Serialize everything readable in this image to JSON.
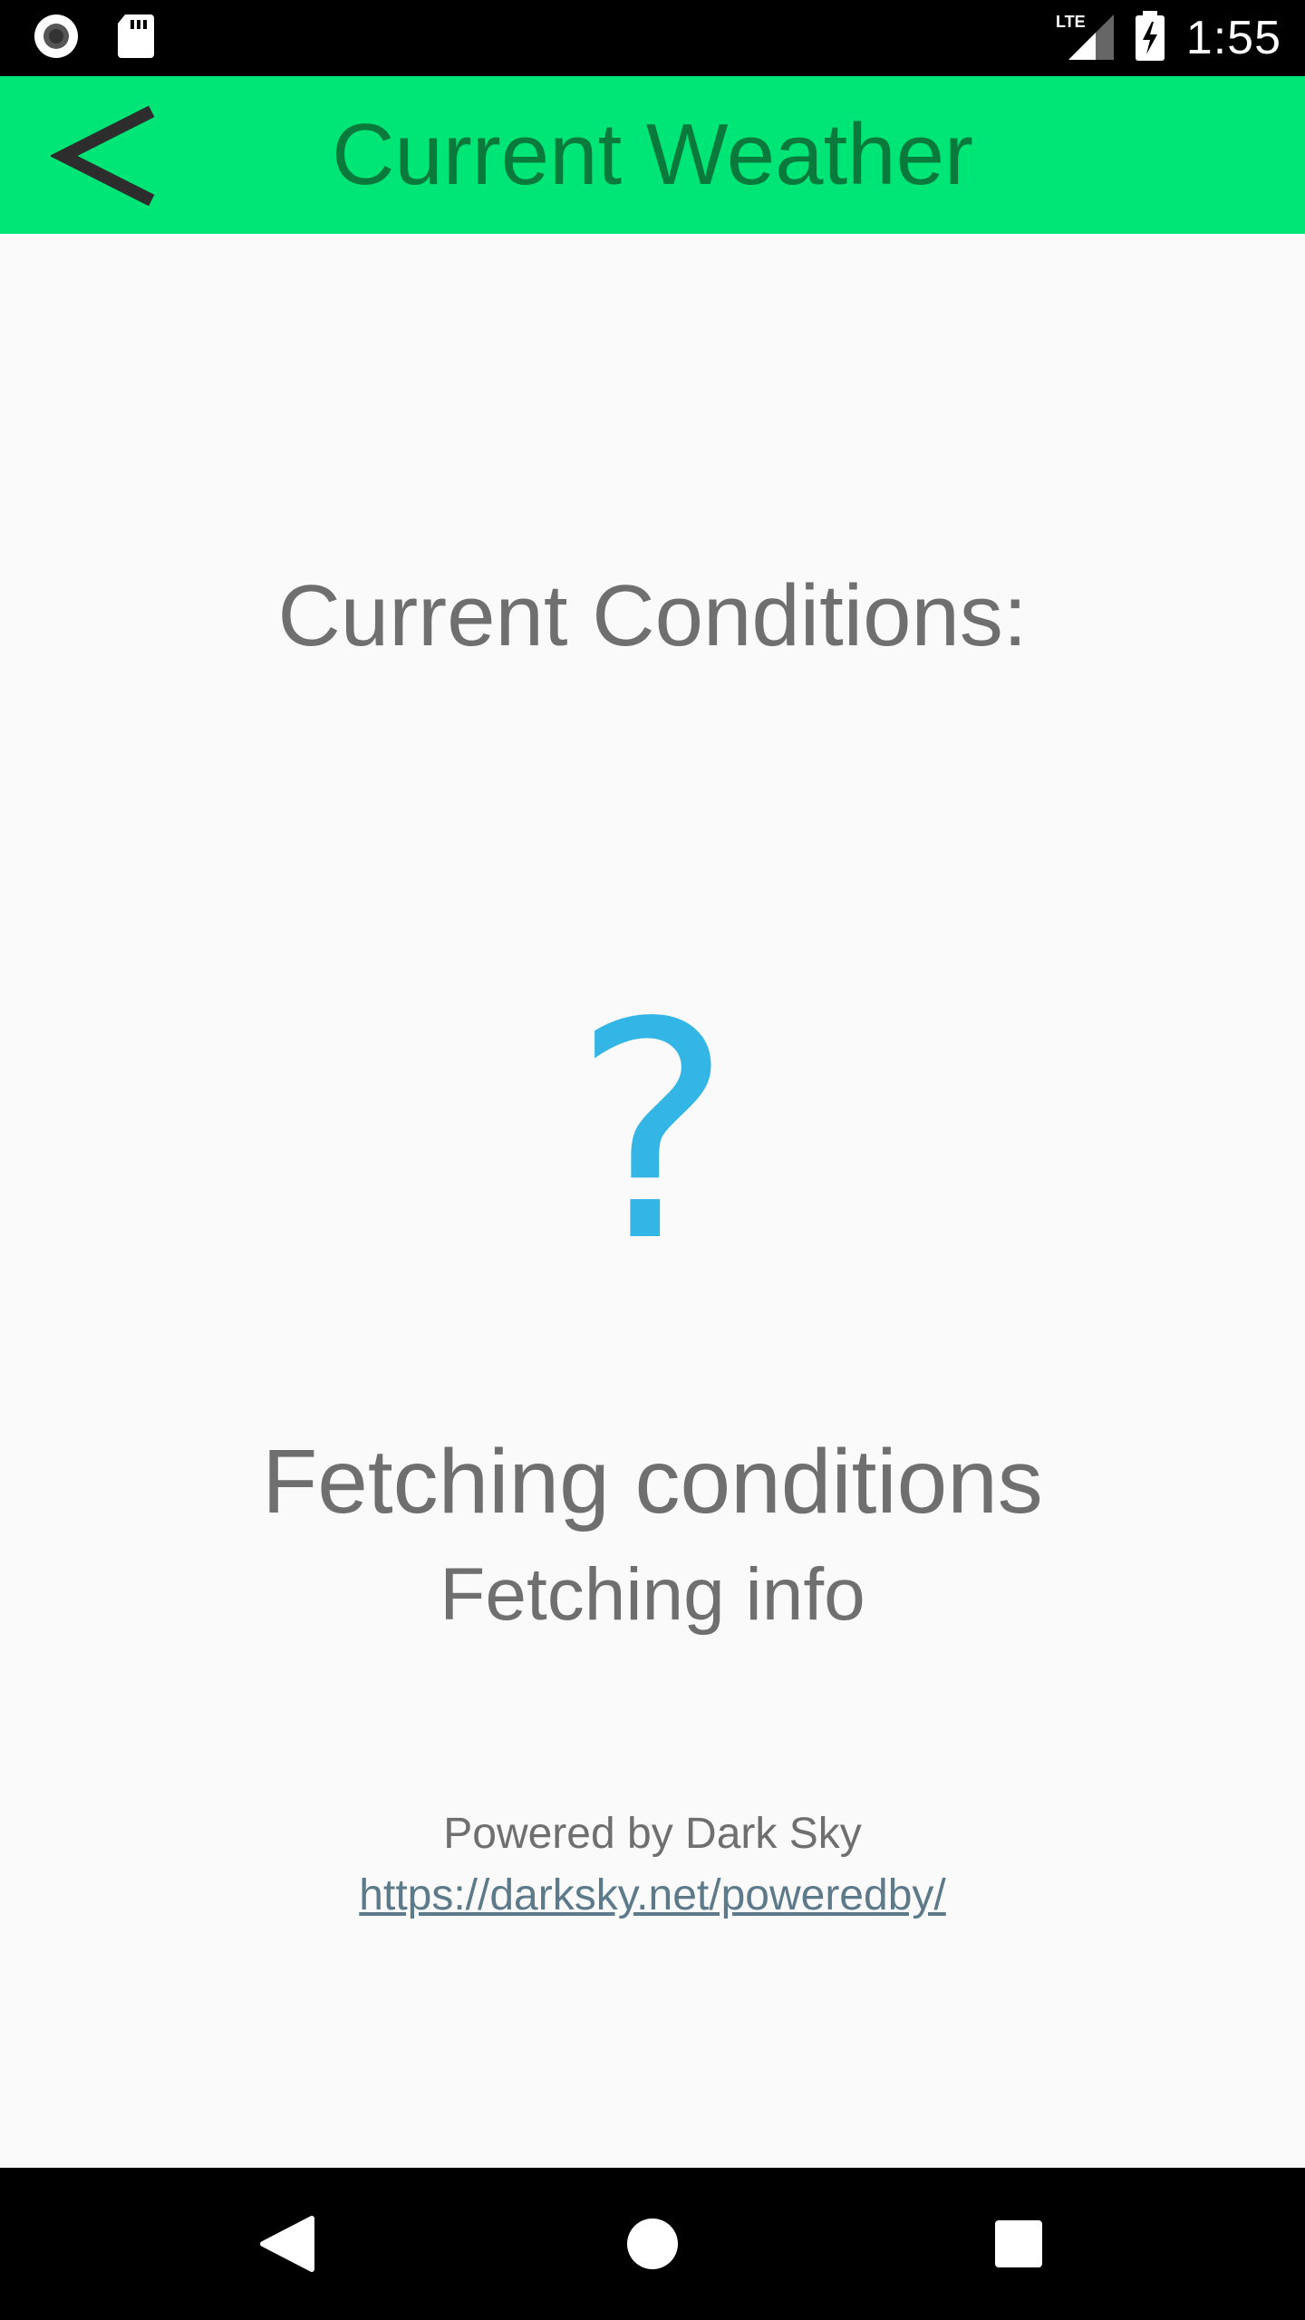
{
  "status_bar": {
    "time": "1:55",
    "network": "LTE",
    "left_icons": [
      "record-icon",
      "sd-card-icon"
    ],
    "right_icons": [
      "lte-signal-icon",
      "battery-charging-icon"
    ]
  },
  "app_bar": {
    "title": "Current Weather",
    "back_icon": "chevron-left-icon",
    "background": "#00e676",
    "title_color": "#0a7a3c"
  },
  "main": {
    "conditions_label": "Current Conditions:",
    "weather_icon_glyph": "?",
    "weather_icon_color": "#33b5e5",
    "conditions_text": "Fetching conditions",
    "info_text": "Fetching info",
    "powered_by": "Powered by Dark Sky",
    "powered_by_link": "https://darksky.net/poweredby/"
  },
  "nav_bar": {
    "buttons": [
      "back-triangle-icon",
      "home-circle-icon",
      "recents-square-icon"
    ]
  }
}
